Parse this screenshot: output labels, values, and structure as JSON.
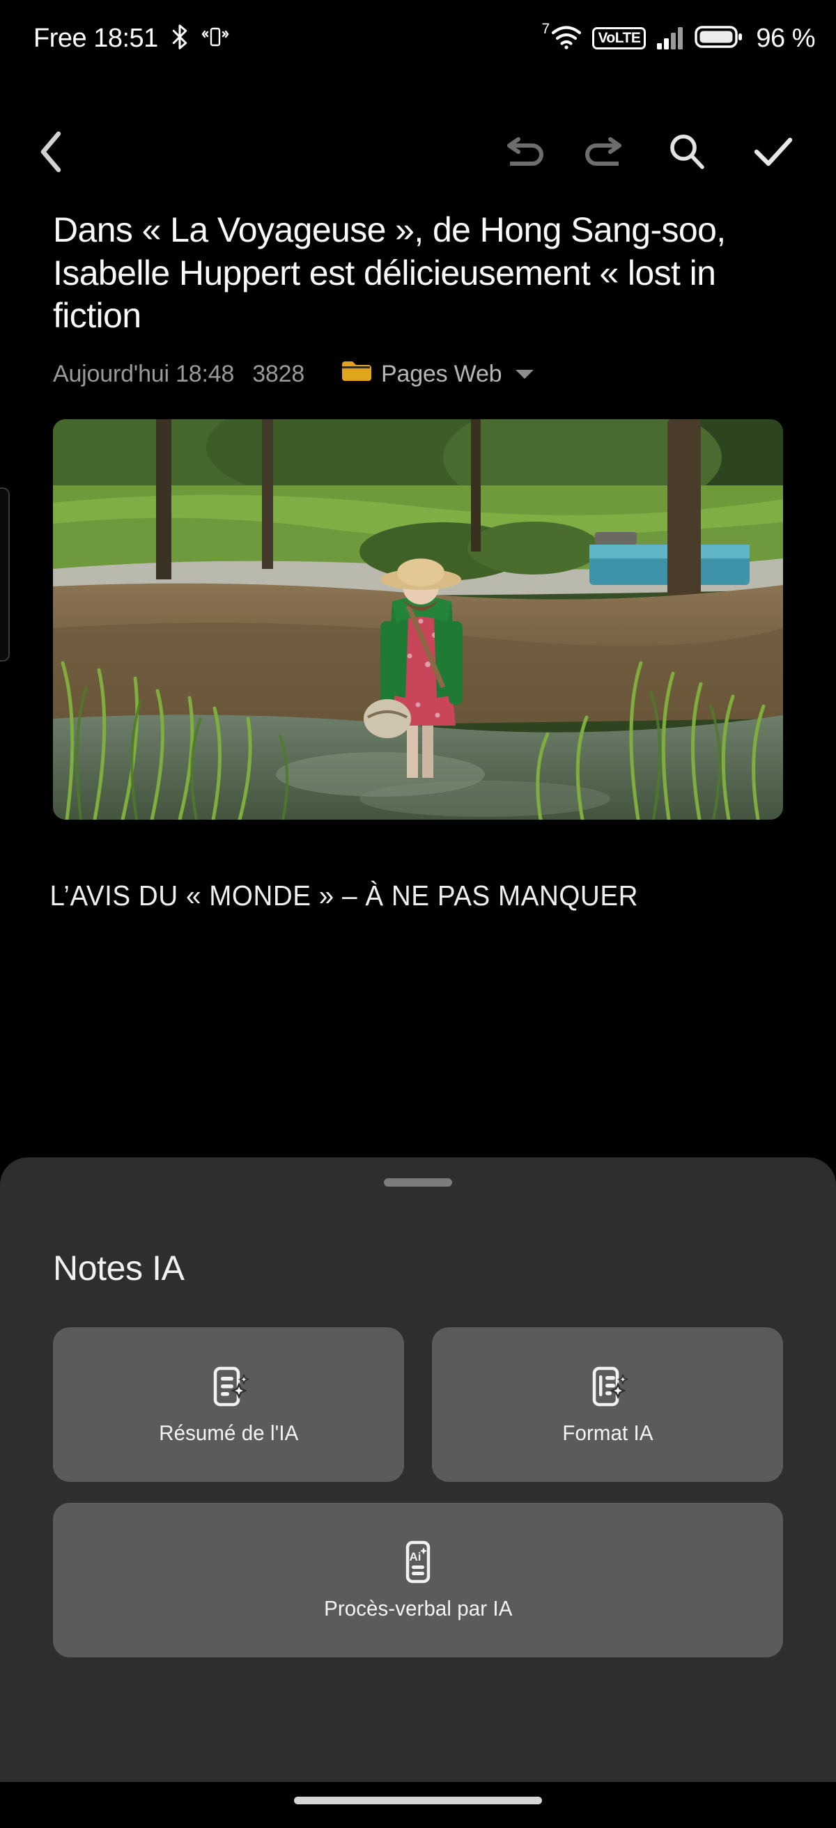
{
  "status_bar": {
    "carrier_and_time": "Free 18:51",
    "bluetooth_icon": "bluetooth-icon",
    "vibrate_icon": "vibrate-icon",
    "wifi_generation": "7",
    "wifi_icon": "wifi-icon",
    "volte_label": "VoLTE",
    "signal_icon": "cellular-signal-icon",
    "battery_icon": "battery-icon",
    "battery_percent": "96 %"
  },
  "toolbar": {
    "back_icon": "back-chevron-icon",
    "undo_icon": "undo-icon",
    "redo_icon": "redo-icon",
    "search_icon": "search-icon",
    "confirm_icon": "checkmark-icon"
  },
  "note": {
    "title": "Dans « La Voyageuse », de Hong Sang-soo, Isabelle Huppert est délicieusement « lost in fiction",
    "date": "Aujourd'hui 18:48",
    "word_count": "3828",
    "folder_icon": "folder-icon",
    "folder_name": "Pages Web",
    "folder_caret_icon": "chevron-down-icon",
    "image_alt": "hero-image-woman-in-green-cardigan-standing-in-stream",
    "body_paragraph": "L’AVIS DU « MONDE » – À NE PAS MANQUER"
  },
  "sheet": {
    "handle": "drag-handle",
    "title": "Notes IA",
    "actions": [
      {
        "label": "Résumé de l'IA",
        "icon": "ai-summary-icon"
      },
      {
        "label": "Format IA",
        "icon": "ai-format-icon"
      },
      {
        "label": "Procès-verbal par IA",
        "icon": "ai-minutes-icon"
      }
    ]
  },
  "colors": {
    "background": "#000000",
    "sheet_background": "#2e2e2e",
    "card_background": "#5b5b5b",
    "folder_accent": "#e0a41d",
    "primary_text": "#fafafa",
    "secondary_text": "#9a9a9a",
    "disabled_icon": "#6d6d6d"
  }
}
